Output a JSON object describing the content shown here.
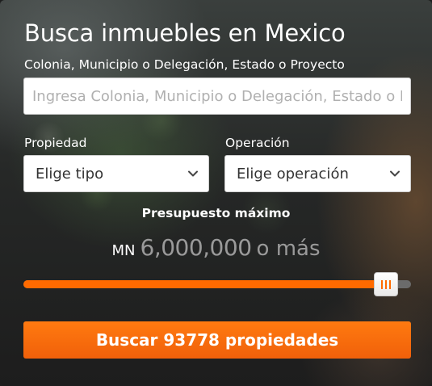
{
  "widget": {
    "title": "Busca inmuebles en Mexico",
    "search": {
      "label": "Colonia, Municipio o Delegación, Estado o Proyecto",
      "placeholder": "Ingresa Colonia, Municipio o Delegación, Estado o Proyecto",
      "value": ""
    },
    "property": {
      "label": "Propiedad",
      "selected": "Elige tipo"
    },
    "operation": {
      "label": "Operación",
      "selected": "Elige operación"
    },
    "budget": {
      "label": "Presupuesto máximo",
      "currency": "MN",
      "value": "6,000,000",
      "suffix": "o más",
      "slider_fraction": 0.965
    },
    "submit_label": "Buscar 93778 propiedades"
  },
  "colors": {
    "accent": "#ff6a00",
    "text": "#ffffff",
    "price_text": "#9a9a9a"
  },
  "icons": {
    "dropdown": "chevron-down-icon",
    "slider_handle": "grip-icon"
  }
}
